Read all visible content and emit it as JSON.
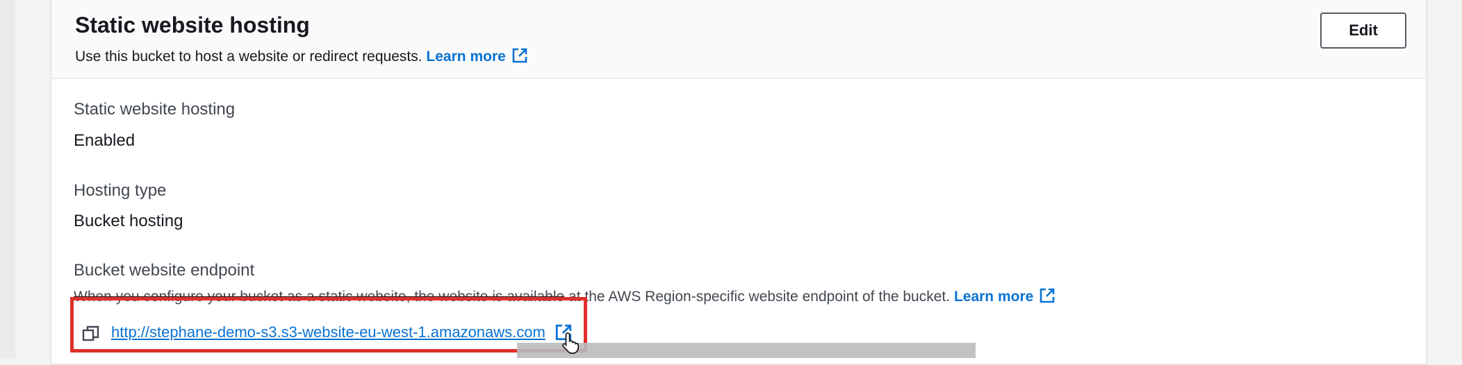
{
  "section": {
    "title": "Static website hosting",
    "description": "Use this bucket to host a website or redirect requests.",
    "learn_more": "Learn more",
    "edit_label": "Edit"
  },
  "fields": {
    "hosting": {
      "label": "Static website hosting",
      "value": "Enabled"
    },
    "hosting_type": {
      "label": "Hosting type",
      "value": "Bucket hosting"
    },
    "endpoint": {
      "label": "Bucket website endpoint",
      "description_prefix": "When you configure your bucket as a static website, the website is available",
      "description_suffix": " at the AWS Region-specific website endpoint of the bucket.",
      "learn_more": "Learn more",
      "url": "http://stephane-demo-s3.s3-website-eu-west-1.amazonaws.com"
    }
  },
  "icons": {
    "external": "external-link-icon",
    "copy": "copy-icon",
    "cursor": "hand-pointer-cursor"
  },
  "colors": {
    "link": "#0972d3",
    "highlight": "#e0302a",
    "text": "#16191f",
    "muted": "#414750"
  }
}
